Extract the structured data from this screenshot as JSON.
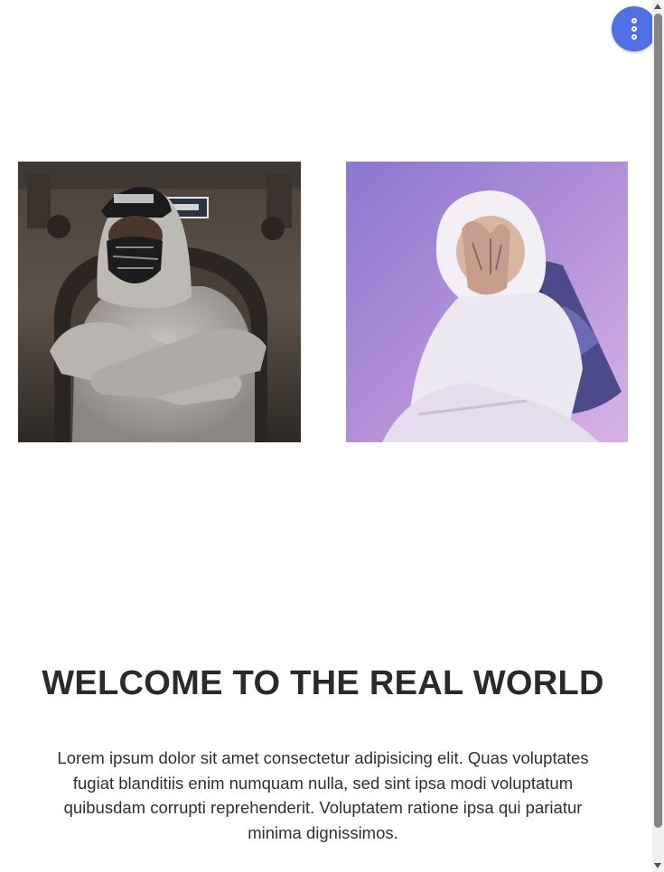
{
  "menu_button": {
    "icon": "more-vertical-icon",
    "color": "#4f6fe4"
  },
  "gallery": [
    {
      "alt": "person in a grey hoodie, cap and bandana mask with arms crossed in front of a stone doorway",
      "accent": "#5a4a3c"
    },
    {
      "alt": "person in a white hoodie covering face with a tattooed hand against a purple background",
      "accent": "#a58ad6"
    }
  ],
  "hero": {
    "title": "WELCOME TO THE REAL WORLD",
    "body": "Lorem ipsum dolor sit amet consectetur adipisicing elit. Quas voluptates fugiat blanditiis enim numquam nulla, sed sint ipsa modi voluptatum quibusdam corrupti reprehenderit. Voluptatem ratione ipsa qui pariatur minima dignissimos."
  }
}
